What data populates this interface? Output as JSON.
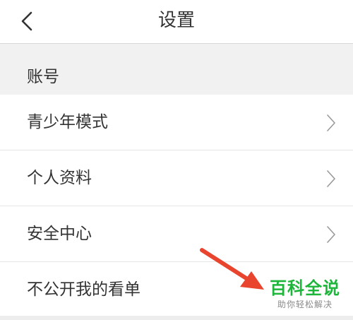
{
  "header": {
    "title": "设置",
    "back_icon": "chevron-left-icon"
  },
  "section": {
    "title": "账号"
  },
  "items": [
    {
      "label": "青少年模式",
      "icon": "chevron-right-icon"
    },
    {
      "label": "个人资料",
      "icon": "chevron-right-icon"
    },
    {
      "label": "安全中心",
      "icon": "chevron-right-icon"
    },
    {
      "label": "不公开我的看单"
    }
  ],
  "watermark": {
    "main": "百科全说",
    "sub": "助你轻松解决",
    "color": "#1db53a"
  },
  "overlay": {
    "arrow_color": "#e8442e"
  }
}
